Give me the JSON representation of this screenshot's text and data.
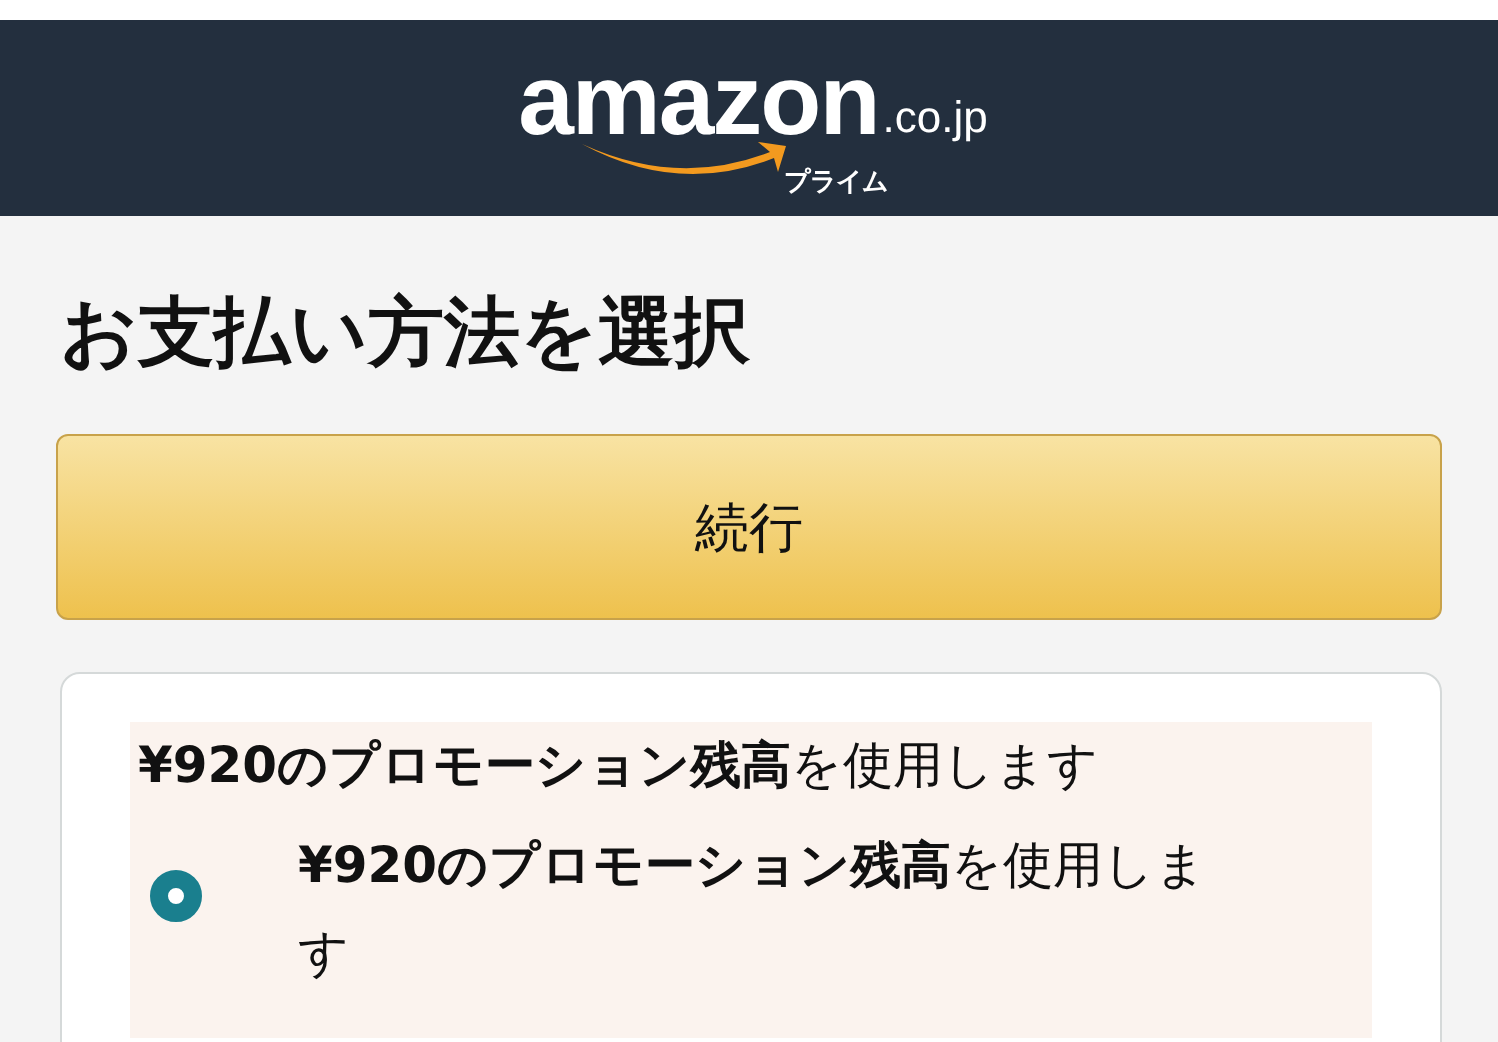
{
  "header": {
    "wordmark": "amazon",
    "domain": ".co.jp",
    "subtitle": "プライム"
  },
  "title": "お支払い方法を選択",
  "continue_button": "続行",
  "promotion": {
    "heading": "**¥920のプロモーション残高**を使用します",
    "options": [
      {
        "label": "**¥920のプロモーション残高**を使用します",
        "selected": true
      }
    ]
  }
}
